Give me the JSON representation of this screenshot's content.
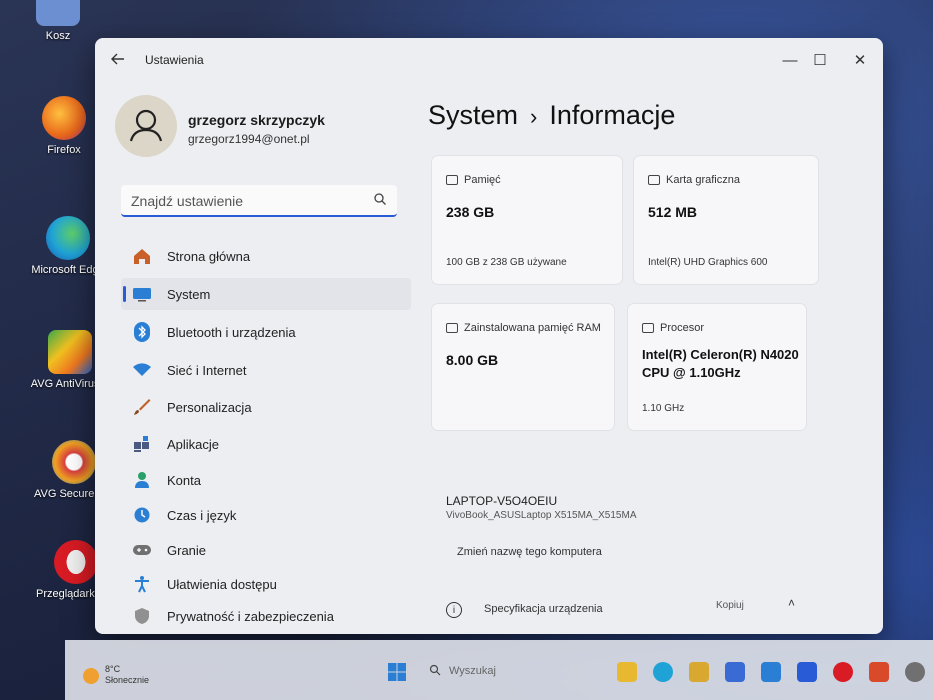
{
  "desktop": {
    "icons": [
      {
        "label": "Kosz",
        "icon": "recycle-bin-icon",
        "color": "#6b8fd0"
      },
      {
        "label": "Firefox",
        "icon": "firefox-icon",
        "color": "#e8661a"
      },
      {
        "label": "Microsoft Edge",
        "icon": "edge-icon",
        "color": "#1fa3d6"
      },
      {
        "label": "AVG AntiVirus F",
        "icon": "avg-antivirus-icon",
        "color": "#f07820"
      },
      {
        "label": "AVG Secure Brow",
        "icon": "avg-secure-browser-icon",
        "color": "#d94040"
      },
      {
        "label": "Przeglądarka Op",
        "icon": "opera-icon",
        "color": "#d81b24"
      }
    ]
  },
  "window": {
    "title": "Ustawienia",
    "controls": {
      "minimize": "—",
      "maximize": "☐",
      "close": "✕"
    }
  },
  "profile": {
    "name": "grzegorz skrzypczyk",
    "email": "grzegorz1994@onet.pl"
  },
  "search": {
    "placeholder": "Znajdź ustawienie"
  },
  "nav": {
    "items": [
      {
        "label": "Strona główna",
        "icon": "home-icon",
        "color": "#c9602a",
        "selected": false
      },
      {
        "label": "System",
        "icon": "system-icon",
        "color": "#2a7fd4",
        "selected": true
      },
      {
        "label": "Bluetooth i urządzenia",
        "icon": "bluetooth-icon",
        "color": "#2a7fd4",
        "selected": false
      },
      {
        "label": "Sieć i Internet",
        "icon": "wifi-icon",
        "color": "#2a7fd4",
        "selected": false
      },
      {
        "label": "Personalizacja",
        "icon": "brush-icon",
        "color": "#c0602a",
        "selected": false
      },
      {
        "label": "Aplikacje",
        "icon": "apps-icon",
        "color": "#4a5a80",
        "selected": false
      },
      {
        "label": "Konta",
        "icon": "account-icon",
        "color": "#2aa06a",
        "selected": false
      },
      {
        "label": "Czas i język",
        "icon": "globe-clock-icon",
        "color": "#2a7fd4",
        "selected": false
      },
      {
        "label": "Granie",
        "icon": "gamepad-icon",
        "color": "#707070",
        "selected": false
      },
      {
        "label": "Ułatwienia dostępu",
        "icon": "accessibility-icon",
        "color": "#2a7fd4",
        "selected": false
      },
      {
        "label": "Prywatność i zabezpieczenia",
        "icon": "shield-icon",
        "color": "#707070",
        "selected": false
      }
    ]
  },
  "page": {
    "section": "System",
    "separator": "›",
    "title": "Informacje"
  },
  "cards": [
    {
      "title": "Pamięć",
      "value": "238 GB",
      "sub": "100 GB z 238 GB używane",
      "icon": "storage-icon"
    },
    {
      "title": "Karta graficzna",
      "value": "512 MB",
      "sub": "Intel(R) UHD Graphics 600",
      "icon": "gpu-icon"
    },
    {
      "title": "Zainstalowana pamięć RAM",
      "value": "8.00 GB",
      "sub": "",
      "icon": "ram-icon"
    },
    {
      "title": "Procesor",
      "value": "Intel(R) Celeron(R) N4020 CPU @ 1.10GHz",
      "sub": "1.10 GHz",
      "icon": "cpu-icon"
    }
  ],
  "device": {
    "name": "LAPTOP-V5O4OEIU",
    "model": "VivoBook_ASUSLaptop X515MA_X515MA",
    "rename_link": "Zmień nazwę tego komputera"
  },
  "spec": {
    "label": "Specyfikacja urządzenia",
    "copy": "Kopiuj",
    "chevron": "˄"
  },
  "taskbar": {
    "weather_temp": "8°C",
    "weather_desc": "Słonecznie",
    "search_placeholder": "Wyszukaj",
    "apps": [
      {
        "icon": "file-explorer-icon",
        "color": "#e8b830"
      },
      {
        "icon": "edge-taskbar-icon",
        "color": "#1fa3d6"
      },
      {
        "icon": "files-icon",
        "color": "#d8a830"
      },
      {
        "icon": "store-icon",
        "color": "#3a6ad4"
      },
      {
        "icon": "mail-icon",
        "color": "#2a7fd4"
      },
      {
        "icon": "myasus-icon",
        "color": "#2a5bd7"
      },
      {
        "icon": "opera-taskbar-icon",
        "color": "#d81b24"
      },
      {
        "icon": "office-icon",
        "color": "#d84a2a"
      },
      {
        "icon": "settings-taskbar-icon",
        "color": "#707070"
      }
    ]
  }
}
